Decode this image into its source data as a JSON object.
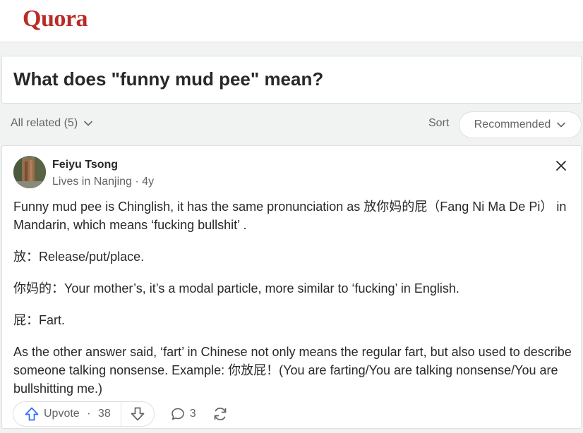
{
  "app": {
    "logo": "Quora",
    "brand_color": "#b92b27"
  },
  "question": {
    "title": "What does \"funny mud pee\" mean?"
  },
  "filters": {
    "all_related": "All related (5)",
    "sort_label": "Sort",
    "sort_value": "Recommended"
  },
  "answer": {
    "author": {
      "name": "Feiyu Tsong",
      "credential": "Lives in Nanjing · 4y"
    },
    "paragraphs": [
      "Funny mud pee is Chinglish, it has the same pronunciation as 放你妈的屁（Fang Ni Ma De Pi） in Mandarin, which means ‘fucking bullshit’ .",
      "放：Release/put/place.",
      "你妈的：Your mother’s, it’s a modal particle, more similar to ‘fucking’ in English.",
      "屁：Fart.",
      "As the other answer said, ‘fart’ in Chinese not only means the regular fart, but also used to describe someone talking nonsense. Example: 你放屁！(You are farting/You are talking nonsense/You are bullshitting me.)"
    ],
    "actions": {
      "upvote_label": "Upvote",
      "upvote_separator": " · ",
      "upvote_count": "38",
      "comment_count": "3"
    }
  },
  "icons": {
    "dropdown": "chevron-down-icon",
    "close": "close-icon",
    "upvote": "arrow-up-icon",
    "downvote": "arrow-down-icon",
    "comment": "comment-bubble-icon",
    "share": "share-arrows-icon"
  },
  "colors": {
    "page_bg": "#f1f2f2",
    "card_bg": "#ffffff",
    "border": "#dee0e1",
    "text_primary": "#282829",
    "text_secondary": "#636466",
    "upvote_blue": "#2e69ff"
  }
}
